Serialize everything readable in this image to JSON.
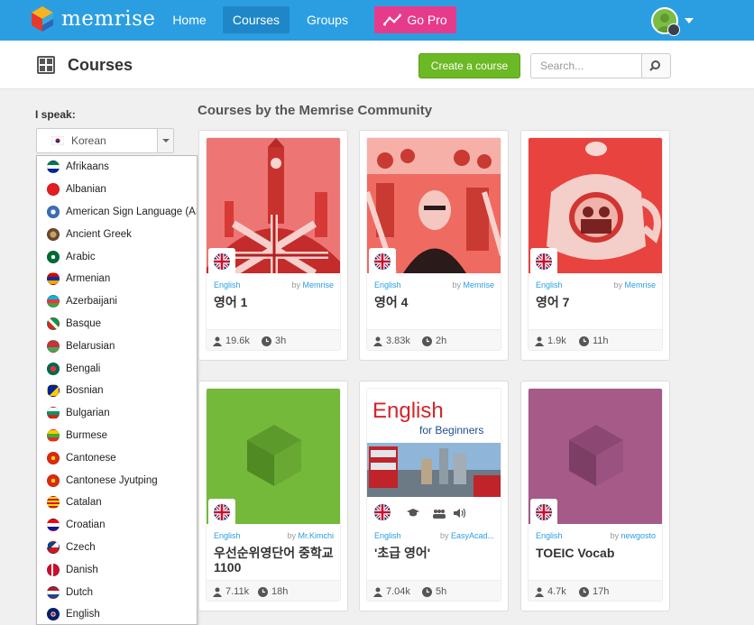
{
  "app": {
    "logo_text": "memrise",
    "brand_color": "#2b9ee2"
  },
  "nav": {
    "home": "Home",
    "courses": "Courses",
    "groups": "Groups",
    "go_pro": "Go Pro"
  },
  "header": {
    "title": "Courses",
    "create_button": "Create a course",
    "search_placeholder": "Search..."
  },
  "sidebar": {
    "speak_label": "I speak:",
    "selected_language": "Korean",
    "languages": [
      "Afrikaans",
      "Albanian",
      "American Sign Language (ASL)",
      "Ancient Greek",
      "Arabic",
      "Armenian",
      "Azerbaijani",
      "Basque",
      "Belarusian",
      "Bengali",
      "Bosnian",
      "Bulgarian",
      "Burmese",
      "Cantonese",
      "Cantonese Jyutping",
      "Catalan",
      "Croatian",
      "Czech",
      "Danish",
      "Dutch",
      "English"
    ]
  },
  "main": {
    "section_title": "Courses by the Memrise Community",
    "courses": [
      {
        "language": "English",
        "by_prefix": "by",
        "author": "Memrise",
        "title": "영어 1",
        "learners": "19.6k",
        "time": "3h"
      },
      {
        "language": "English",
        "by_prefix": "by",
        "author": "Memrise",
        "title": "영어 4",
        "learners": "3.83k",
        "time": "2h"
      },
      {
        "language": "English",
        "by_prefix": "by",
        "author": "Memrise",
        "title": "영어 7",
        "learners": "1.9k",
        "time": "11h"
      },
      {
        "language": "English",
        "by_prefix": "by",
        "author": "Mr.Kimchi",
        "title": "우선순위영단어 중학교 1100",
        "learners": "7.11k",
        "time": "18h"
      },
      {
        "language": "English",
        "by_prefix": "by",
        "author": "EasyAcad...",
        "title": "'초급 영어'",
        "learners": "7.04k",
        "time": "5h",
        "image_text": "English",
        "image_subtext": "for Beginners"
      },
      {
        "language": "English",
        "by_prefix": "by",
        "author": "newgosto",
        "title": "TOEIC Vocab",
        "learners": "4.7k",
        "time": "17h"
      }
    ]
  }
}
